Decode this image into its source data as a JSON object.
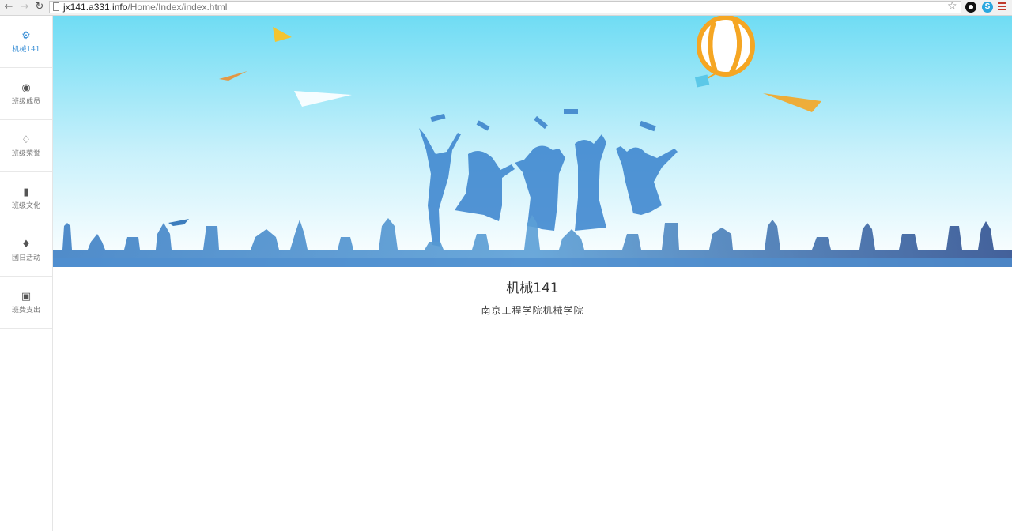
{
  "browser": {
    "url_host": "jx141.a331.info",
    "url_path": "/Home/Index/index.html"
  },
  "sidebar": {
    "items": [
      {
        "label": "机械141",
        "icon": "gears-icon",
        "glyph": "⚙",
        "active": true
      },
      {
        "label": "班级成员",
        "icon": "user-circle-icon",
        "glyph": "◉",
        "active": false
      },
      {
        "label": "班级荣誉",
        "icon": "diamond-icon",
        "glyph": "♢",
        "active": false
      },
      {
        "label": "班级文化",
        "icon": "book-icon",
        "glyph": "▮",
        "active": false
      },
      {
        "label": "团日活动",
        "icon": "microphone-icon",
        "glyph": "♦",
        "active": false
      },
      {
        "label": "班费支出",
        "icon": "money-icon",
        "glyph": "▣",
        "active": false
      }
    ]
  },
  "main": {
    "title": "机械141",
    "subtitle": "南京工程学院机械学院"
  },
  "colors": {
    "accent": "#3a8fd6",
    "sky_top": "#6fdcf4",
    "sky_bottom": "#ffffff",
    "silhouette": "#2f6db5",
    "balloon": "#f5a623"
  }
}
